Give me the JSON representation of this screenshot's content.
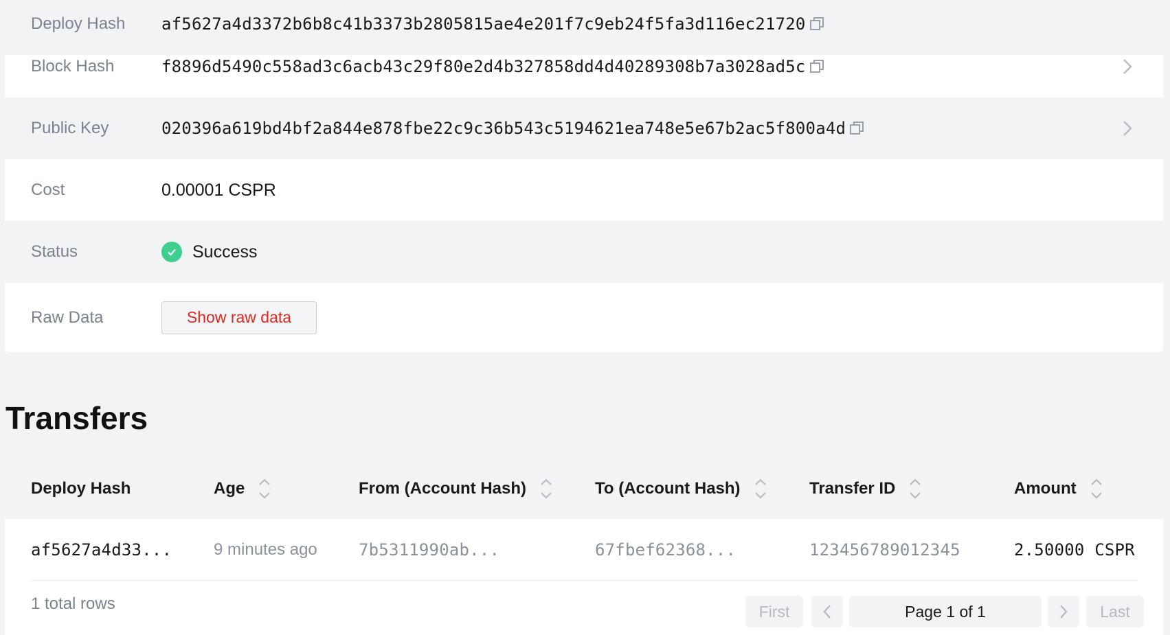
{
  "details": {
    "deploy_hash": {
      "label": "Deploy Hash",
      "value": "af5627a4d3372b6b8c41b3373b2805815ae4e201f7c9eb24f5fa3d116ec21720"
    },
    "block_hash": {
      "label": "Block Hash",
      "value": "f8896d5490c558ad3c6acb43c29f80e2d4b327858dd4d40289308b7a3028ad5c"
    },
    "public_key": {
      "label": "Public Key",
      "value": "020396a619bd4bf2a844e878fbe22c9c36b543c5194621ea748e5e67b2ac5f800a4d"
    },
    "cost": {
      "label": "Cost",
      "value": "0.00001 CSPR"
    },
    "status": {
      "label": "Status",
      "value": "Success"
    },
    "raw_data": {
      "label": "Raw Data",
      "button": "Show raw data"
    }
  },
  "transfers": {
    "title": "Transfers",
    "columns": [
      "Deploy Hash",
      "Age",
      "From (Account Hash)",
      "To (Account Hash)",
      "Transfer ID",
      "Amount"
    ],
    "rows": [
      {
        "deploy_hash": "af5627a4d33...",
        "age": "9 minutes ago",
        "from": "7b5311990ab...",
        "to": "67fbef62368...",
        "transfer_id": "123456789012345",
        "amount": "2.50000 CSPR"
      }
    ],
    "total_rows": "1 total rows",
    "pagination": {
      "first": "First",
      "page": "Page 1 of 1",
      "last": "Last"
    }
  },
  "colors": {
    "accent_red": "#e0281e",
    "success_green": "#3ecf8e",
    "background": "#f2f3f5"
  },
  "icons": [
    "copy-icon",
    "chevron-right-icon",
    "check-circle-icon",
    "sort-icon",
    "chevron-left-icon"
  ]
}
